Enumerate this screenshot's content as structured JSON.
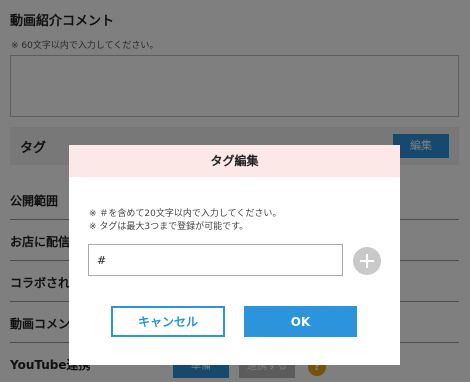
{
  "background": {
    "section_title": "動画紹介コメント",
    "section_note": "※ 60文字以内で入力してください。",
    "tag_label": "タグ",
    "edit_button": "編集",
    "rows": [
      "公開範囲",
      "お店に配信",
      "コラボされ",
      "動画コメン"
    ],
    "bottom_label": "YouTube連携",
    "bottom_btn_blue": "準備",
    "bottom_btn_gray": "連携する",
    "help_icon": "?"
  },
  "modal": {
    "title": "タグ編集",
    "notes": [
      "※ ＃を含めて20文字以内で入力してください。",
      "※ タグは最大3つまで登録が可能です。"
    ],
    "tag_input_value": "#",
    "add_icon": "plus-icon",
    "cancel_label": "キャンセル",
    "ok_label": "OK"
  },
  "colors": {
    "accent": "#2b94dd",
    "modal_header": "#fde8e8",
    "overlay": "rgba(0,0,0,0.5)"
  }
}
